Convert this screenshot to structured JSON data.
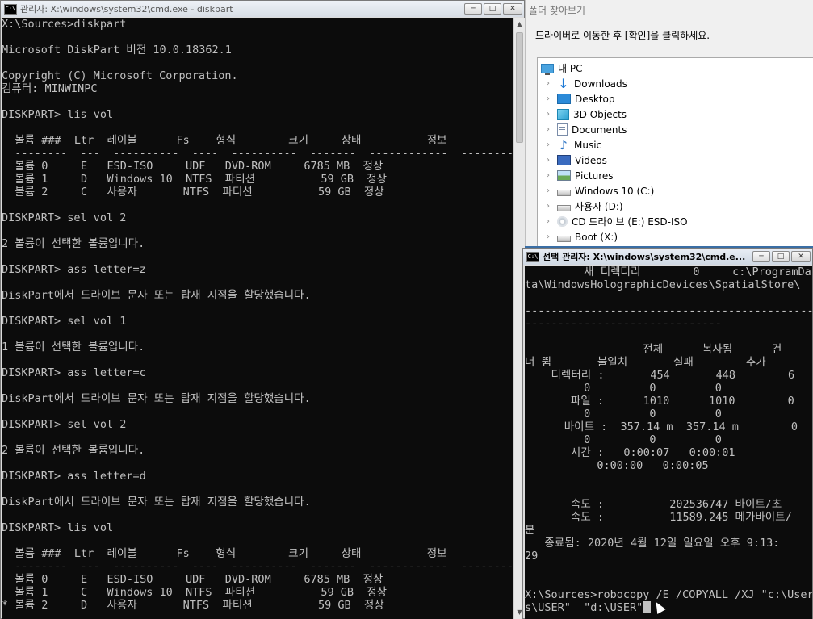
{
  "left_window": {
    "title": "관리자: X:\\windows\\system32\\cmd.exe - diskpart",
    "icon_text": "C:\\",
    "lines": [
      "X:\\Sources>diskpart",
      "",
      "Microsoft DiskPart 버전 10.0.18362.1",
      "",
      "Copyright (C) Microsoft Corporation.",
      "컴퓨터: MINWINPC",
      "",
      "DISKPART> lis vol",
      "",
      "  볼륨 ###  Ltr  레이블      Fs    형식        크기     상태          정보",
      "  --------  ---  ----------  ----  ----------  -------  ------------  --------",
      "  볼륨 0     E   ESD-ISO     UDF   DVD-ROM     6785 MB  정상",
      "  볼륨 1     D   Windows 10  NTFS  파티션          59 GB  정상",
      "  볼륨 2     C   사용자       NTFS  파티션          59 GB  정상",
      "",
      "DISKPART> sel vol 2",
      "",
      "2 볼륨이 선택한 볼륨입니다.",
      "",
      "DISKPART> ass letter=z",
      "",
      "DiskPart에서 드라이브 문자 또는 탑재 지점을 할당했습니다.",
      "",
      "DISKPART> sel vol 1",
      "",
      "1 볼륨이 선택한 볼륨입니다.",
      "",
      "DISKPART> ass letter=c",
      "",
      "DiskPart에서 드라이브 문자 또는 탑재 지점을 할당했습니다.",
      "",
      "DISKPART> sel vol 2",
      "",
      "2 볼륨이 선택한 볼륨입니다.",
      "",
      "DISKPART> ass letter=d",
      "",
      "DiskPart에서 드라이브 문자 또는 탑재 지점을 할당했습니다.",
      "",
      "DISKPART> lis vol",
      "",
      "  볼륨 ###  Ltr  레이블      Fs    형식        크기     상태          정보",
      "  --------  ---  ----------  ----  ----------  -------  ------------  --------",
      "  볼륨 0     E   ESD-ISO     UDF   DVD-ROM     6785 MB  정상",
      "  볼륨 1     C   Windows 10  NTFS  파티션          59 GB  정상",
      "* 볼륨 2     D   사용자       NTFS  파티션          59 GB  정상"
    ]
  },
  "folder_dialog": {
    "title": "폴더 찾아보기",
    "instruction": "드라이버로 이동한 후 [확인]을 클릭하세요.",
    "root": {
      "label": "내 PC",
      "icon": "pc-icon"
    },
    "items": [
      {
        "label": "Downloads",
        "icon": "downloads-icon"
      },
      {
        "label": "Desktop",
        "icon": "desktop-icon"
      },
      {
        "label": "3D Objects",
        "icon": "3d-objects-icon"
      },
      {
        "label": "Documents",
        "icon": "documents-icon"
      },
      {
        "label": "Music",
        "icon": "music-icon"
      },
      {
        "label": "Videos",
        "icon": "videos-icon"
      },
      {
        "label": "Pictures",
        "icon": "pictures-icon"
      },
      {
        "label": "Windows 10 (C:)",
        "icon": "drive-icon"
      },
      {
        "label": "사용자 (D:)",
        "icon": "drive-icon"
      },
      {
        "label": "CD 드라이브 (E:) ESD-ISO",
        "icon": "cd-drive-icon"
      },
      {
        "label": "Boot (X:)",
        "icon": "drive-icon"
      }
    ]
  },
  "right_window": {
    "title": "선택 관리자: X:\\windows\\system32\\cmd.e...",
    "icon_text": "C:\\",
    "lines": [
      "         새 디렉터리        0     c:\\ProgramDa",
      "ta\\WindowsHolographicDevices\\SpatialStore\\",
      "",
      "------------------------------------------------",
      "------------------------------",
      "",
      "                  전체      복사됨      건",
      "너 뜀       불일치       실패        추가",
      "    디렉터리 :       454       448        6",
      "         0         0         0",
      "       파일 :      1010      1010        0",
      "         0         0         0",
      "      바이트 :  357.14 m  357.14 m        0",
      "         0         0         0",
      "       시간 :   0:00:07   0:00:01",
      "           0:00:00   0:00:05",
      "",
      "",
      "       속도 :          202536747 바이트/초",
      "       속도 :          11589.245 메가바이트/",
      "분",
      "   종료됨: 2020년 4월 12일 일요일 오후 9:13:",
      "29",
      "",
      "",
      "X:\\Sources>robocopy /E /COPYALL /XJ \"c:\\User",
      "s\\USER\"  \"d:\\USER\""
    ]
  },
  "controls": {
    "minimize": "─",
    "maximize": "□",
    "close": "✕"
  }
}
